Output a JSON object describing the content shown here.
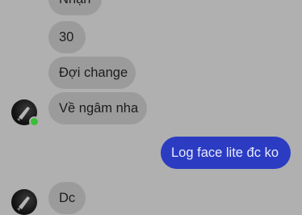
{
  "conversation": {
    "messages": [
      {
        "id": "m1",
        "direction": "received",
        "text": "Nhận"
      },
      {
        "id": "m2",
        "direction": "received",
        "text": "30"
      },
      {
        "id": "m3",
        "direction": "received",
        "text": "Đợi change"
      },
      {
        "id": "m4",
        "direction": "received",
        "text": "Về ngâm nha"
      },
      {
        "id": "m5",
        "direction": "sent",
        "text": "Log face lite đc ko"
      },
      {
        "id": "m6",
        "direction": "received",
        "text": "Dc"
      }
    ]
  },
  "contact": {
    "online": true,
    "avatar_icon": "contact-avatar"
  },
  "colors": {
    "background": "#b0b0b0",
    "received_bubble": "#9b9b9b",
    "sent_bubble": "#2b3cc2",
    "online_indicator": "#3bbf3b"
  }
}
